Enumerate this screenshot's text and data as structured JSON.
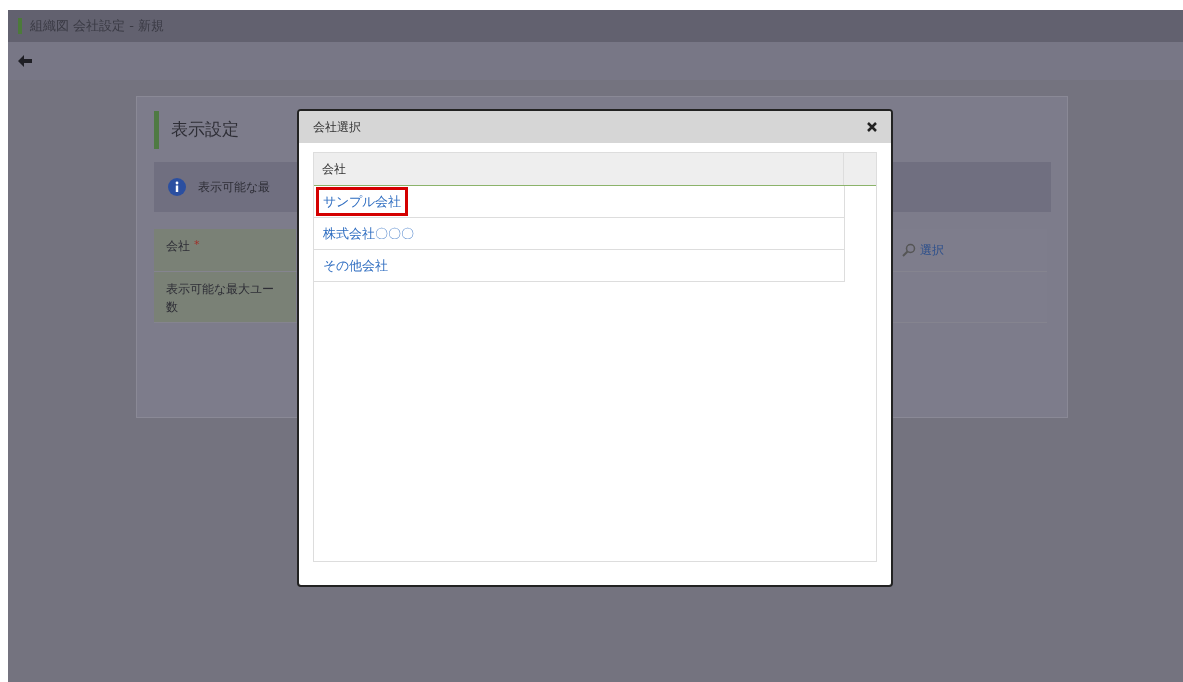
{
  "window": {
    "title": "組織図 会社設定 - 新規"
  },
  "section": {
    "title": "表示設定",
    "info": "表示可能な最"
  },
  "form": {
    "rows": [
      {
        "label": "会社",
        "required_mark": "*",
        "action": "選択"
      },
      {
        "label": "表示可能な最大ユー",
        "label_line_2": "数"
      }
    ]
  },
  "dialog": {
    "title": "会社選択",
    "table": {
      "columns": [
        "会社"
      ],
      "rows": [
        {
          "name": "サンプル会社",
          "selected": true
        },
        {
          "name": "株式会社〇〇〇",
          "selected": false
        },
        {
          "name": "その他会社",
          "selected": false
        }
      ]
    }
  }
}
